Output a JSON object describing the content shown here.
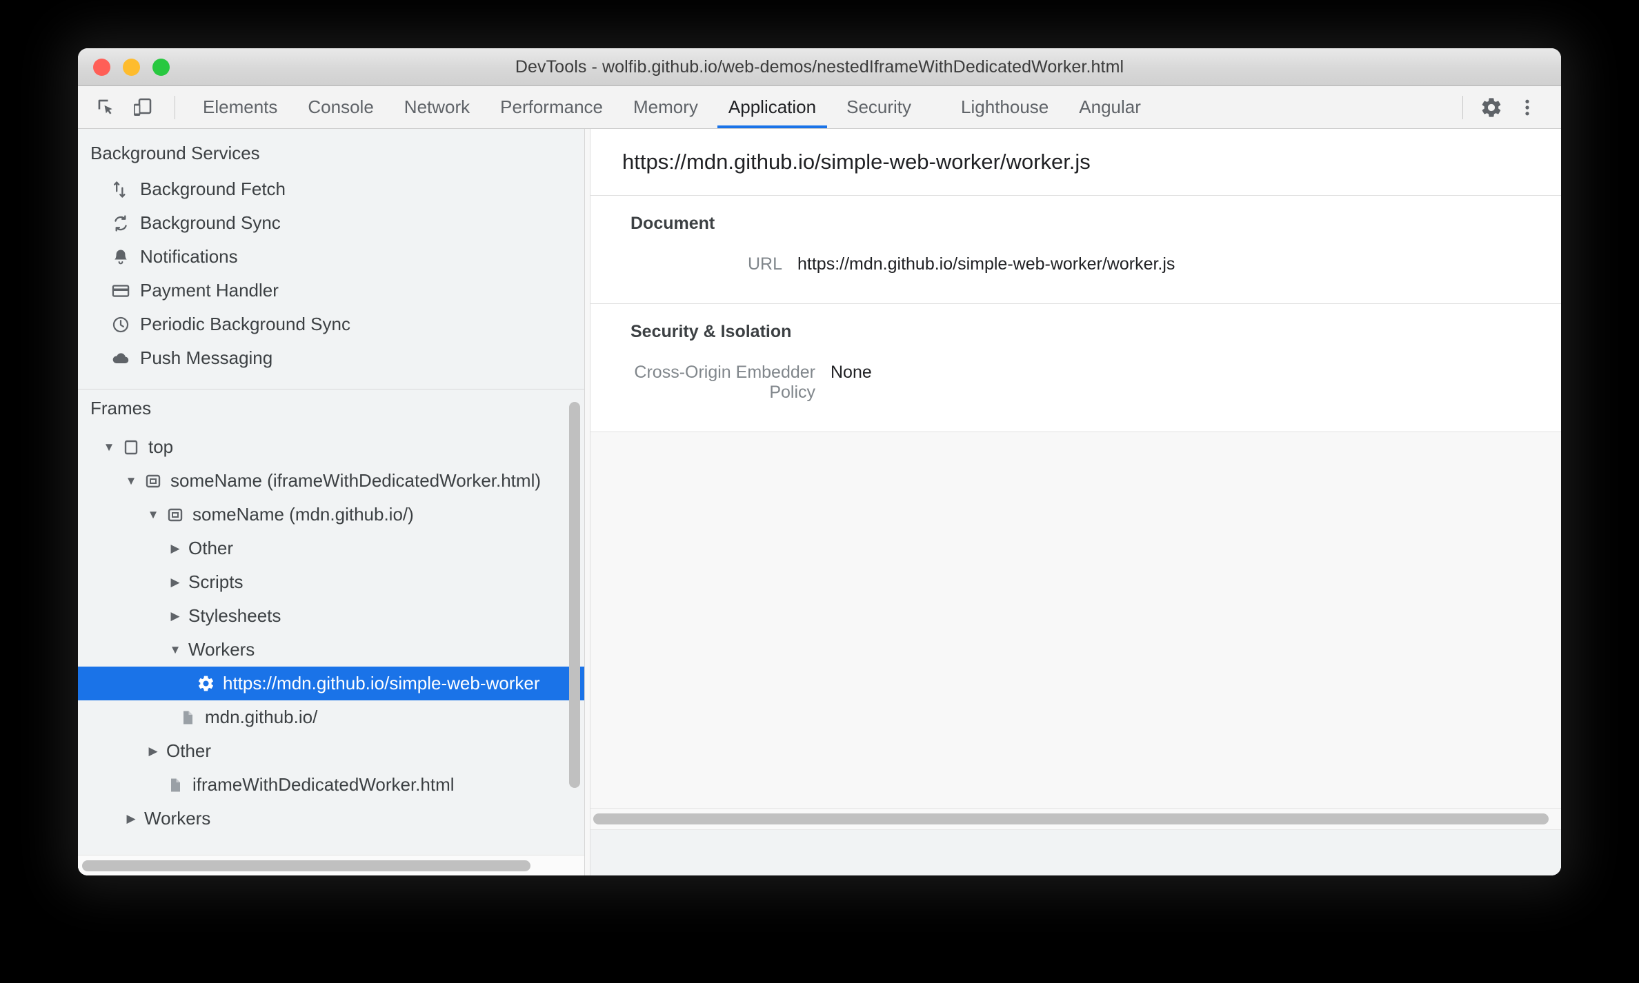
{
  "window": {
    "title": "DevTools - wolfib.github.io/web-demos/nestedIframeWithDedicatedWorker.html",
    "traffic_lights": [
      "close",
      "minimize",
      "maximize"
    ]
  },
  "toolbar": {
    "inspect_icon": "inspect-element-icon",
    "device_icon": "device-toolbar-icon",
    "settings_icon": "gear-icon",
    "more_icon": "kebab-menu-icon",
    "tabs": [
      {
        "label": "Elements",
        "active": false
      },
      {
        "label": "Console",
        "active": false
      },
      {
        "label": "Network",
        "active": false
      },
      {
        "label": "Performance",
        "active": false
      },
      {
        "label": "Memory",
        "active": false
      },
      {
        "label": "Application",
        "active": true
      },
      {
        "label": "Security",
        "active": false
      },
      {
        "label": "Lighthouse",
        "active": false
      },
      {
        "label": "Angular",
        "active": false
      }
    ],
    "accent_color": "#1a73e8"
  },
  "sidebar": {
    "background_services": {
      "title": "Background Services",
      "items": [
        {
          "label": "Background Fetch",
          "icon": "background-fetch-icon"
        },
        {
          "label": "Background Sync",
          "icon": "background-sync-icon"
        },
        {
          "label": "Notifications",
          "icon": "bell-icon"
        },
        {
          "label": "Payment Handler",
          "icon": "credit-card-icon"
        },
        {
          "label": "Periodic Background Sync",
          "icon": "clock-icon"
        },
        {
          "label": "Push Messaging",
          "icon": "cloud-icon"
        }
      ]
    },
    "frames": {
      "title": "Frames",
      "tree": [
        {
          "label": "top",
          "icon": "frame-icon",
          "twisty": "down",
          "indent": 0,
          "selected": false
        },
        {
          "label": "someName (iframeWithDedicatedWorker.html)",
          "icon": "iframe-icon",
          "twisty": "down",
          "indent": 1,
          "selected": false
        },
        {
          "label": "someName (mdn.github.io/)",
          "icon": "iframe-icon",
          "twisty": "down",
          "indent": 2,
          "selected": false
        },
        {
          "label": "Other",
          "icon": "none",
          "twisty": "right",
          "indent": 3,
          "selected": false
        },
        {
          "label": "Scripts",
          "icon": "none",
          "twisty": "right",
          "indent": 3,
          "selected": false
        },
        {
          "label": "Stylesheets",
          "icon": "none",
          "twisty": "right",
          "indent": 3,
          "selected": false
        },
        {
          "label": "Workers",
          "icon": "none",
          "twisty": "down",
          "indent": 3,
          "selected": false
        },
        {
          "label": "https://mdn.github.io/simple-web-worker",
          "icon": "worker-gear-icon",
          "twisty": "none",
          "indent": 4,
          "selected": true
        },
        {
          "label": "mdn.github.io/",
          "icon": "document-icon",
          "twisty": "none",
          "indent": 3,
          "selected": false
        },
        {
          "label": "Other",
          "icon": "none",
          "twisty": "right",
          "indent": 2,
          "selected": false
        },
        {
          "label": "iframeWithDedicatedWorker.html",
          "icon": "document-icon",
          "twisty": "none",
          "indent": 2,
          "selected": false
        },
        {
          "label": "Workers",
          "icon": "none",
          "twisty": "right",
          "indent": 1,
          "selected": false
        }
      ]
    },
    "selection_color": "#1a73e8"
  },
  "main": {
    "header_url": "https://mdn.github.io/simple-web-worker/worker.js",
    "document_section": {
      "title": "Document",
      "rows": [
        {
          "key": "URL",
          "value": "https://mdn.github.io/simple-web-worker/worker.js"
        }
      ]
    },
    "security_section": {
      "title": "Security & Isolation",
      "rows": [
        {
          "key": "Cross-Origin Embedder Policy",
          "value": "None"
        }
      ]
    }
  }
}
